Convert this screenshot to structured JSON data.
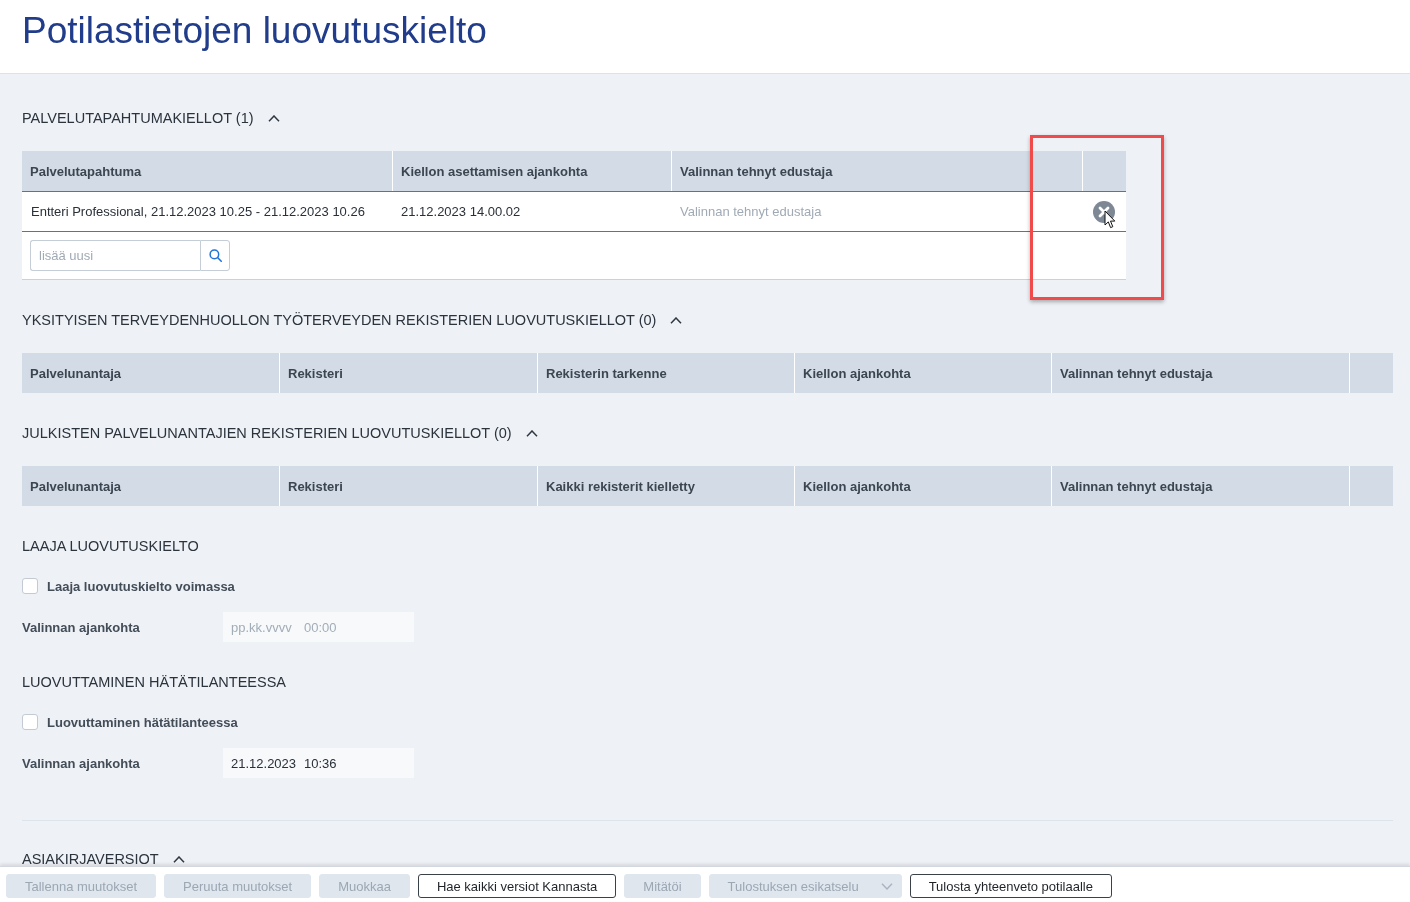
{
  "title": "Potilastietojen luovutuskielto",
  "sections": [
    {
      "kind": "event_bans",
      "heading": "PALVELUTAPAHTUMAKIELLOT (1)",
      "expanded": true,
      "columns": [
        "Palvelutapahtuma",
        "Kiellon asettamisen ajankohta",
        "Valinnan tehnyt edustaja"
      ],
      "rows": [
        {
          "service_event": "Entteri Professional, 21.12.2023 10.25 - 21.12.2023 10.26",
          "ban_time": "21.12.2023 14.00.02",
          "representative": {
            "placeholder": "Valinnan tehnyt edustaja"
          }
        }
      ],
      "add_field": {
        "placeholder": "lisää uusi"
      }
    },
    {
      "kind": "register_bans",
      "heading": "YKSITYISEN TERVEYDENHUOLLON TYÖTERVEYDEN REKISTERIEN LUOVUTUSKIELLOT (0)",
      "expanded": true,
      "columns": [
        "Palvelunantaja",
        "Rekisteri",
        "Rekisterin tarkenne",
        "Kiellon ajankohta",
        "Valinnan tehnyt edustaja"
      ]
    },
    {
      "kind": "register_bans",
      "heading": "JULKISTEN PALVELUNANTAJIEN REKISTERIEN LUOVUTUSKIELLOT (0)",
      "expanded": true,
      "columns": [
        "Palvelunantaja",
        "Rekisteri",
        "Kaikki rekisterit kielletty",
        "Kiellon ajankohta",
        "Valinnan tehnyt edustaja"
      ]
    },
    {
      "kind": "option",
      "heading": "LAAJA LUOVUTUSKIELTO",
      "checkbox": {
        "label": "Laaja luovutuskielto voimassa",
        "checked": false
      },
      "field": {
        "label": "Valinnan ajankohta",
        "date": {
          "placeholder": "pp.kk.vvvv"
        },
        "time": {
          "placeholder": "00:00"
        }
      }
    },
    {
      "kind": "option",
      "heading": "LUOVUTTAMINEN HÄTÄTILANTEESSA",
      "checkbox": {
        "label": "Luovuttaminen hätätilanteessa",
        "checked": false
      },
      "field": {
        "label": "Valinnan ajankohta",
        "date": {
          "value": "21.12.2023"
        },
        "time": {
          "value": "10:36"
        }
      }
    },
    {
      "kind": "versions",
      "heading": "ASIAKIRJAVERSIOT",
      "expanded": true
    }
  ],
  "actions": [
    {
      "kind": "button",
      "label": "Tallenna muutokset",
      "disabled": true
    },
    {
      "kind": "button",
      "label": "Peruuta muutokset",
      "disabled": true
    },
    {
      "kind": "button",
      "label": "Muokkaa",
      "disabled": true
    },
    {
      "kind": "button",
      "label": "Hae kaikki versiot Kannasta",
      "disabled": false
    },
    {
      "kind": "button",
      "label": "Mitätöi",
      "disabled": true
    },
    {
      "kind": "dropdown",
      "label": "Tulostuksen esikatselu",
      "disabled": true
    },
    {
      "kind": "button",
      "label": "Tulosta yhteenveto potilaalle",
      "disabled": false
    }
  ]
}
